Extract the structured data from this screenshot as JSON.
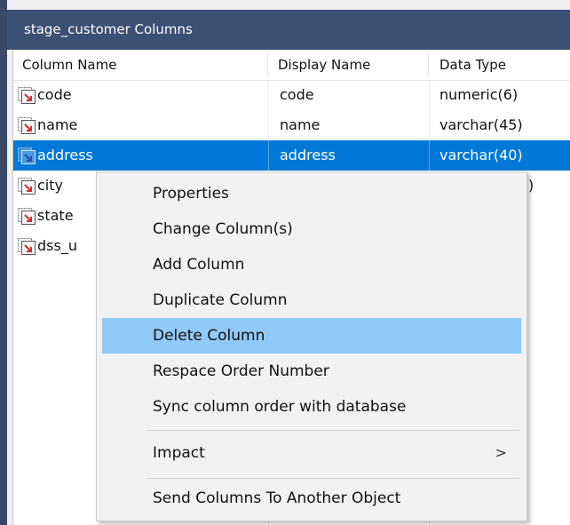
{
  "window": {
    "title": "stage_customer Columns"
  },
  "columns_header": [
    "Column Name",
    "Display Name",
    "Data Type"
  ],
  "rows": [
    {
      "column_name": "code",
      "display_name": "code",
      "data_type": "numeric(6)"
    },
    {
      "column_name": "name",
      "display_name": "name",
      "data_type": "varchar(45)"
    },
    {
      "column_name": "address",
      "display_name": "address",
      "data_type": "varchar(40)",
      "selected": true
    },
    {
      "column_name": "city",
      "display_name": "",
      "data_type": ")"
    },
    {
      "column_name": "state",
      "display_name": "",
      "data_type": ""
    },
    {
      "column_name": "dss_u",
      "display_name": "",
      "data_type": ""
    }
  ],
  "context_menu": {
    "items": [
      {
        "label": "Properties"
      },
      {
        "label": "Change Column(s)"
      },
      {
        "label": "Add Column"
      },
      {
        "label": "Duplicate Column"
      },
      {
        "label": "Delete Column",
        "highlighted": true
      },
      {
        "label": "Respace Order Number"
      },
      {
        "label": "Sync column order with database"
      },
      {
        "label": "Impact",
        "submenu_glyph": ">"
      },
      {
        "label": "Send Columns To Another Object"
      }
    ]
  },
  "colors": {
    "titlebar": "#3c5073",
    "selection": "#0078d7",
    "menu_highlight": "#91c9f7",
    "column_icon_arrow": "#d42a2a"
  }
}
